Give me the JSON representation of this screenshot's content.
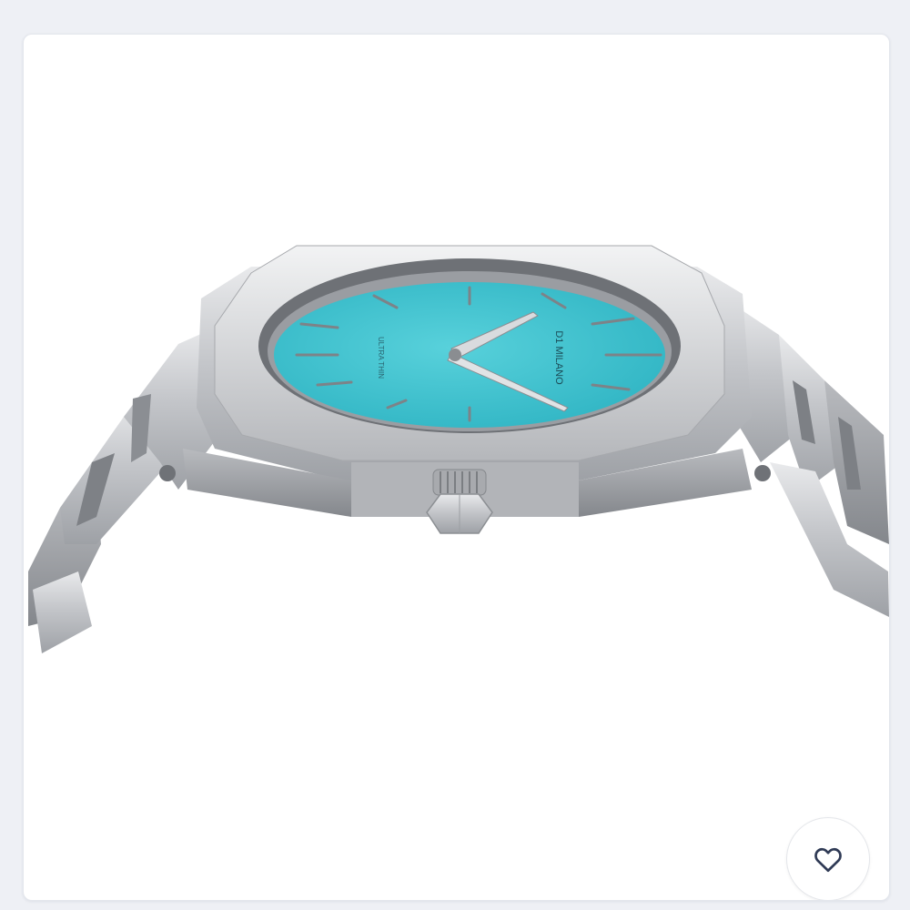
{
  "product": {
    "image_alt": "D1 Milano Ultra Thin watch, turquoise dial, steel bracelet, side view",
    "dial_brand": "D1 MILANO",
    "dial_model": "ULTRA THIN",
    "dial_color": "#3ec3cf",
    "case_color": "#c9cbcf"
  },
  "actions": {
    "favorite_icon": "heart-outline-icon"
  }
}
